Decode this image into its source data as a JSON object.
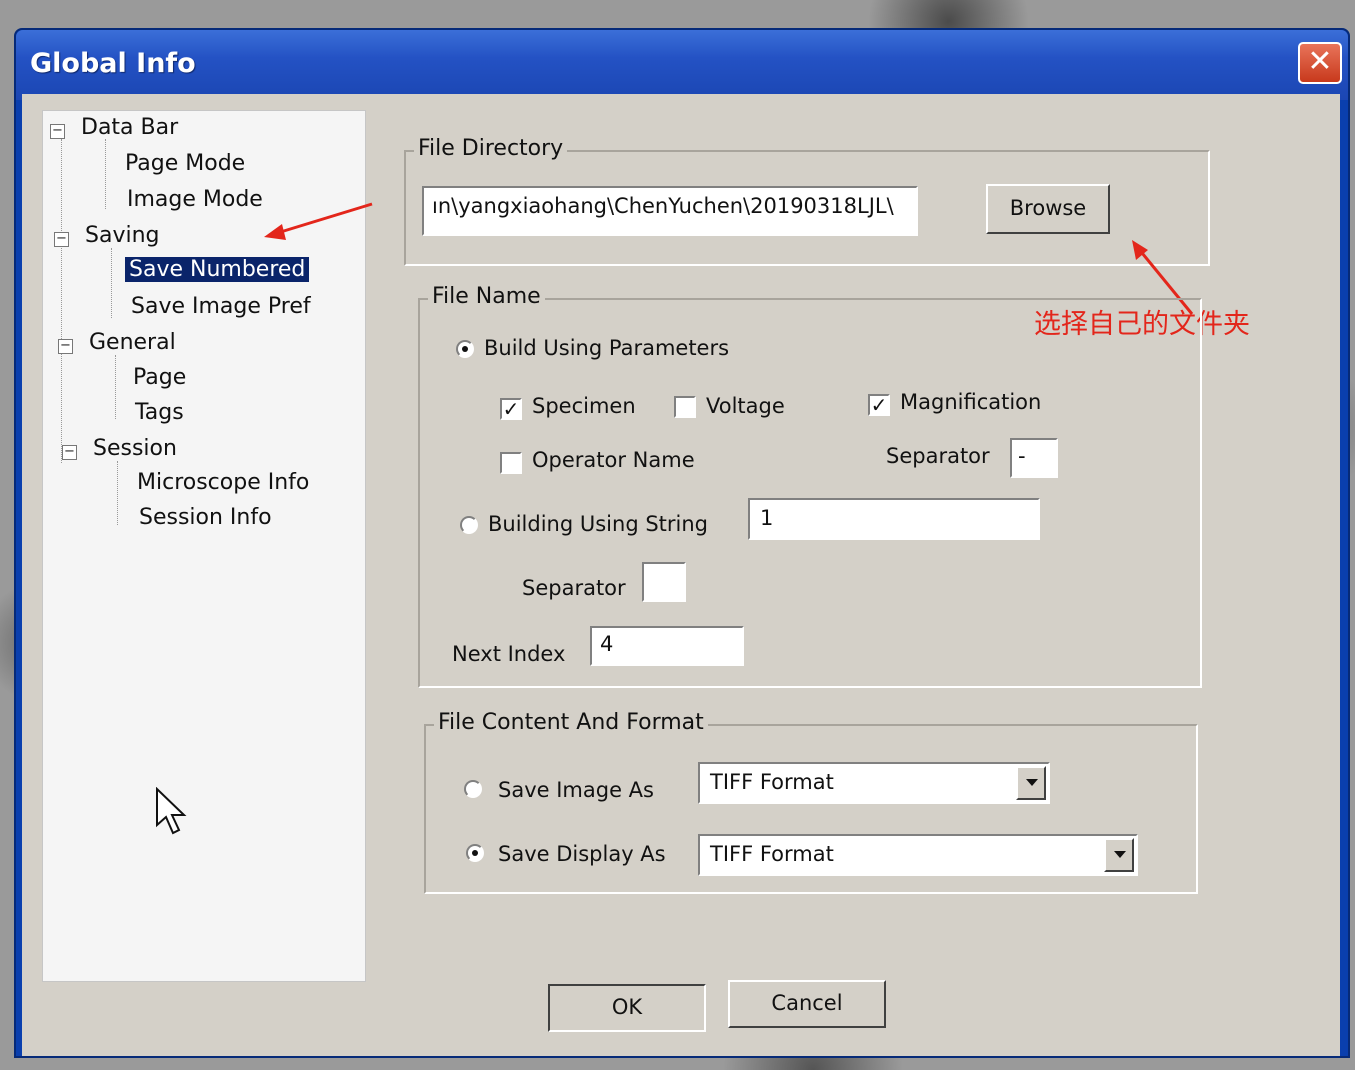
{
  "window": {
    "title": "Global Info",
    "close_label": "✕"
  },
  "tree": {
    "items": [
      {
        "label": "Data Bar",
        "expander": "−"
      },
      {
        "label": "Page Mode"
      },
      {
        "label": "Image Mode"
      },
      {
        "label": "Saving",
        "expander": "−"
      },
      {
        "label": "Save Numbered"
      },
      {
        "label": "Save Image Pref"
      },
      {
        "label": "General",
        "expander": "−"
      },
      {
        "label": "Page"
      },
      {
        "label": "Tags"
      },
      {
        "label": "Session",
        "expander": "−"
      },
      {
        "label": "Microscope Info"
      },
      {
        "label": "Session Info"
      }
    ]
  },
  "file_directory": {
    "group_label": "File Directory",
    "path_value": "ın\\yangxiaohang\\ChenYuchen\\20190318LJL\\",
    "browse_label": "Browse"
  },
  "annotation": {
    "text": "选择自己的文件夹",
    "color": "#e3261b"
  },
  "file_name": {
    "group_label": "File Name",
    "build_params_label": "Build Using Parameters",
    "specimen_label": "Specimen",
    "voltage_label": "Voltage",
    "magnification_label": "Magnification",
    "operator_label": "Operator Name",
    "separator_label": "Separator",
    "separator_value": "-",
    "build_string_label": "Building Using String",
    "string_value": "1",
    "string_separator_label": "Separator",
    "string_separator_value": "",
    "next_index_label": "Next Index",
    "next_index_value": "4"
  },
  "file_content": {
    "group_label": "File Content And Format",
    "save_image_label": "Save Image As",
    "save_image_format": "TIFF Format",
    "save_display_label": "Save Display As",
    "save_display_format": "TIFF Format"
  },
  "footer": {
    "ok_label": "OK",
    "cancel_label": "Cancel"
  },
  "colors": {
    "title_bar": "#2452c4",
    "selected": "#0a246a",
    "dialog_bg": "#d4d0c8"
  }
}
